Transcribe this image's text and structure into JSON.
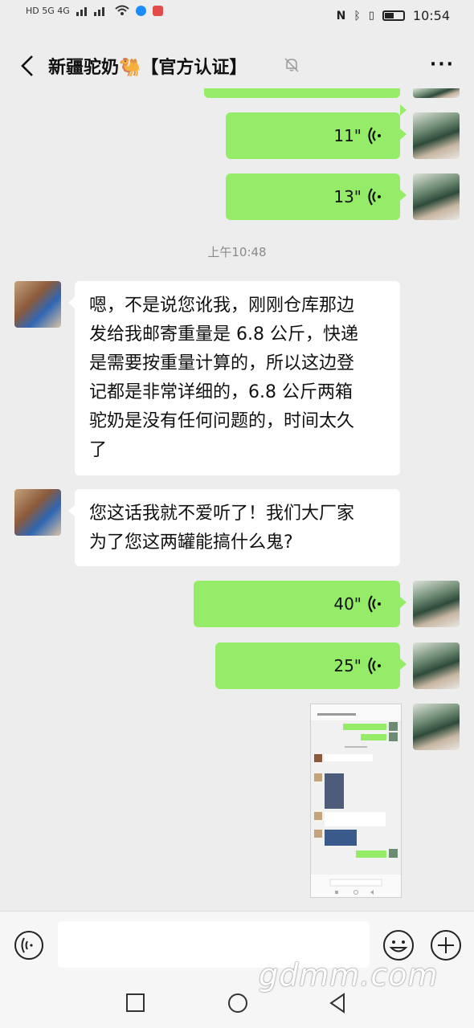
{
  "status_bar": {
    "network": "HD 5G 4G",
    "time": "10:54"
  },
  "header": {
    "title": "新疆驼奶🐫【官方认证】",
    "more_label": "···"
  },
  "messages": {
    "m1": {
      "duration": "11\""
    },
    "m2": {
      "duration": "13\""
    },
    "timestamp": "上午10:48",
    "m3": {
      "lines": [
        "嗯，不是说您讹我，刚刚仓库那边",
        "发给我邮寄重量是 6.8 公斤，快递",
        "是需要按重量计算的，所以这边登",
        "记都是非常详细的，6.8 公斤两箱",
        "驼奶是没有任何问题的，时间太久",
        "了"
      ]
    },
    "m4": {
      "lines": [
        "您这话我就不爱听了！我们大厂家",
        "为了您这两罐能搞什么鬼?"
      ]
    },
    "m5": {
      "duration": "40\""
    },
    "m6": {
      "duration": "25\""
    }
  },
  "watermark": "gdmm.com",
  "colors": {
    "my_bubble": "#95ec69",
    "their_bubble": "#ffffff",
    "background": "#ededed"
  },
  "icons": [
    "back-icon",
    "mute-bell-icon",
    "voice-wave-icon",
    "voice-input-icon",
    "emoji-icon",
    "plus-icon",
    "nav-square-icon",
    "nav-circle-icon",
    "nav-triangle-icon"
  ]
}
